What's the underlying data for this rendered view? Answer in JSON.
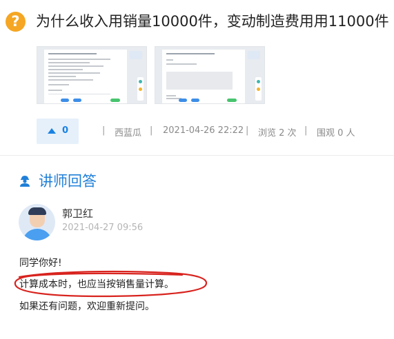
{
  "question": {
    "icon": "question-mark-icon",
    "title": "为什么收入用销量10000件，变动制造费用用11000件"
  },
  "thumbnails": [
    {
      "name": "attachment-thumbnail-1"
    },
    {
      "name": "attachment-thumbnail-2"
    }
  ],
  "meta": {
    "vote_count": "0",
    "separator": "|",
    "author": "西蓝瓜",
    "datetime": "2021-04-26 22:22",
    "views": "浏览 2 次",
    "watchers": "围观 0 人"
  },
  "answer_section": {
    "icon": "lecturer-icon",
    "title": "讲师回答",
    "teacher_name": "郭卫红",
    "answer_time": "2021-04-27 09:56",
    "paragraphs": [
      "同学你好!",
      "计算成本时，也应当按销售量计算。",
      "如果还有问题，欢迎重新提问。"
    ]
  },
  "colors": {
    "accent": "#1f7fd8",
    "question_icon": "#f5a623",
    "annotation": "#d8231e"
  }
}
